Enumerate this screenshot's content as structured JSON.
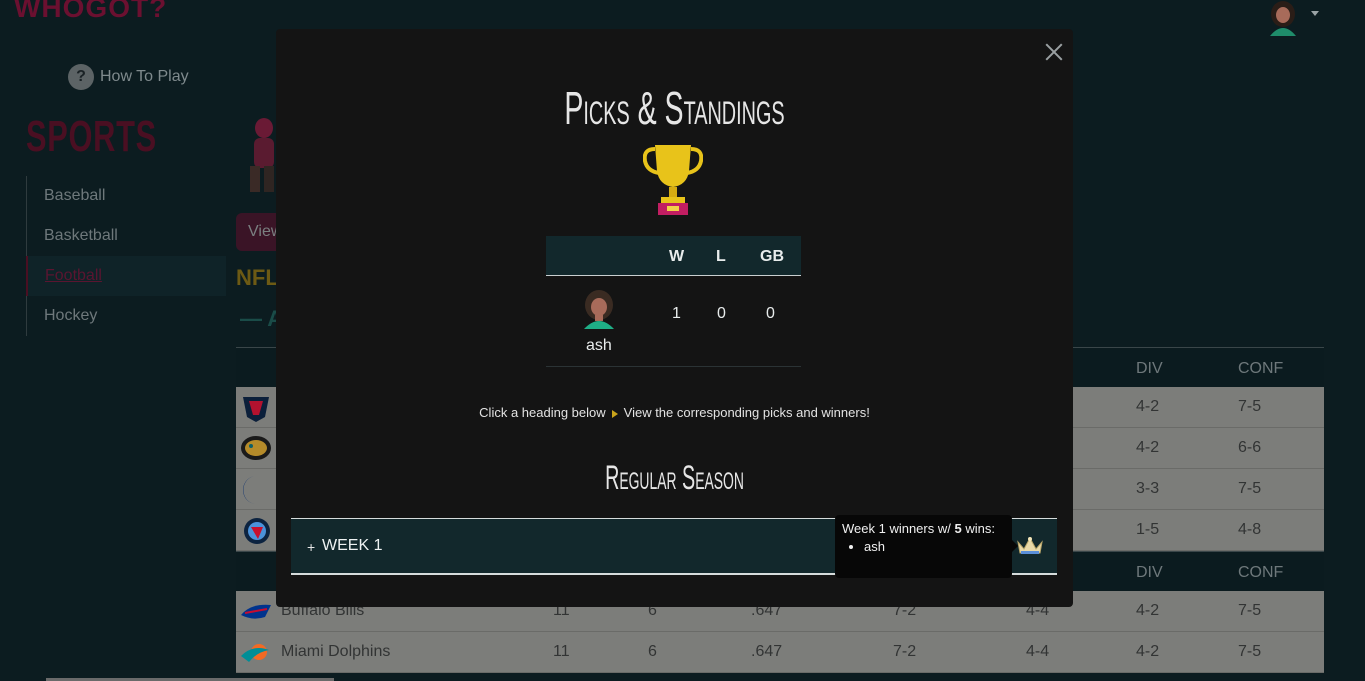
{
  "app": {
    "logo_text": "WHOGOT?"
  },
  "nav": {
    "how_to_play": "How To Play"
  },
  "sidebar": {
    "title": "SPORTS",
    "items": [
      {
        "label": "Baseball"
      },
      {
        "label": "Basketball"
      },
      {
        "label": "Football",
        "active": true
      },
      {
        "label": "Hockey"
      }
    ]
  },
  "main": {
    "view_button": "View",
    "league": "NFL",
    "conference_heading": "— AM",
    "standings_header": {
      "div": "DIV",
      "conf": "CONF"
    },
    "rows_top": [
      {
        "team_icon": "texans-logo",
        "div": "4-2",
        "conf": "7-5"
      },
      {
        "team_icon": "jaguars-logo",
        "div": "4-2",
        "conf": "6-6"
      },
      {
        "team_icon": "colts-logo",
        "div": "3-3",
        "conf": "7-5"
      },
      {
        "team_icon": "titans-logo",
        "div": "1-5",
        "conf": "4-8"
      }
    ],
    "rows_bottom": [
      {
        "team_icon": "bills-logo",
        "team": "Buffalo Bills",
        "w": "11",
        "l": "6",
        "pct": ".647",
        "home": "7-2",
        "away": "4-4",
        "div": "4-2",
        "conf": "7-5"
      },
      {
        "team_icon": "dolphins-logo",
        "team": "Miami Dolphins",
        "w": "11",
        "l": "6",
        "pct": ".647",
        "home": "7-2",
        "away": "4-4",
        "div": "4-2",
        "conf": "7-5"
      }
    ]
  },
  "modal": {
    "title": "Picks & Standings",
    "table": {
      "headers": {
        "w": "W",
        "l": "L",
        "gb": "GB"
      },
      "rows": [
        {
          "user": "ash",
          "w": "1",
          "l": "0",
          "gb": "0"
        }
      ]
    },
    "hint_left": "Click a heading below",
    "hint_right": "View the corresponding picks and winners!",
    "section_title": "Regular Season",
    "weeks": [
      {
        "plus": "+",
        "label": "WEEK 1"
      }
    ],
    "tooltip": {
      "prefix": "Week 1 winners w/ ",
      "wins": "5",
      "suffix": " wins:",
      "winners": [
        "ash"
      ]
    }
  },
  "colors": {
    "accent_crimson": "#6b1030",
    "modal_bg": "#141414",
    "table_head_bg": "#12282c",
    "gold": "#c9a41b"
  }
}
